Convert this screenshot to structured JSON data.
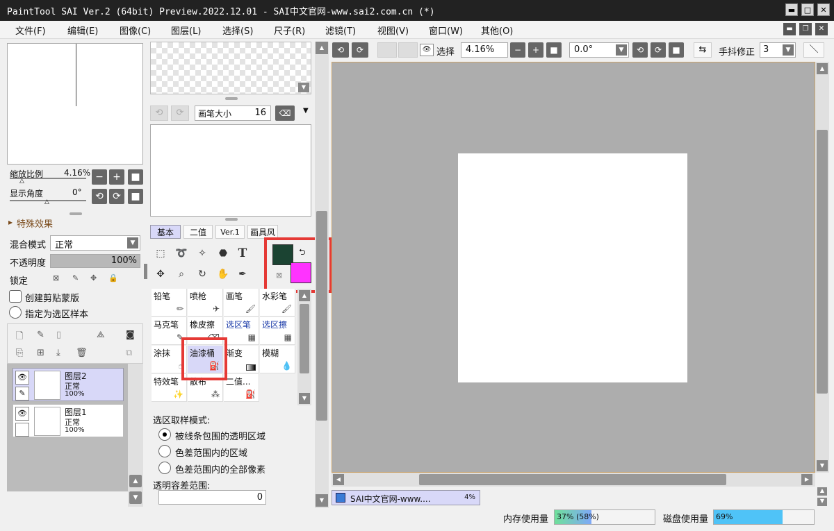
{
  "window": {
    "title": "PaintTool SAI Ver.2 (64bit) Preview.2022.12.01 - SAI中文官网-www.sai2.com.cn (*)",
    "min": "▬",
    "max": "□",
    "close": "✕"
  },
  "menu": [
    "文件(F)",
    "编辑(E)",
    "图像(C)",
    "图层(L)",
    "选择(S)",
    "尺子(R)",
    "滤镜(T)",
    "视图(V)",
    "窗口(W)",
    "其他(O)"
  ],
  "menu_buttons": {
    "min": "▬",
    "restore": "❐",
    "close": "✕"
  },
  "navigator": {
    "zoom_label": "缩放比例",
    "zoom_value": "4.16%",
    "angle_label": "显示角度",
    "angle_value": "0°"
  },
  "effects": {
    "label": "特殊效果"
  },
  "layer_props": {
    "blend_label": "混合模式",
    "blend_value": "正常",
    "opacity_label": "不透明度",
    "opacity_value": "100%",
    "opacity_fraction": 1.0,
    "lock_label": "锁定",
    "clip_label": "创建剪贴蒙版",
    "sample_label": "指定为选区样本"
  },
  "layers": [
    {
      "name": "图层2",
      "mode": "正常",
      "opacity": "100%",
      "selected": true
    },
    {
      "name": "图层1",
      "mode": "正常",
      "opacity": "100%",
      "selected": false
    }
  ],
  "brush_settings": {
    "size_label": "画笔大小",
    "size_value": "16"
  },
  "tool_tabs": [
    "基本",
    "二值",
    "Ver.1",
    "画具风"
  ],
  "colors": {
    "primary": "#1b4332",
    "secondary": "#ff33ff",
    "highlight": "#e53935"
  },
  "brushes": [
    {
      "name": "铅笔"
    },
    {
      "name": "喷枪"
    },
    {
      "name": "画笔"
    },
    {
      "name": "水彩笔"
    },
    {
      "name": "马克笔"
    },
    {
      "name": "橡皮擦"
    },
    {
      "name": "选区笔"
    },
    {
      "name": "选区擦"
    },
    {
      "name": "涂抹"
    },
    {
      "name": "油漆桶"
    },
    {
      "name": "渐变"
    },
    {
      "name": "模糊"
    },
    {
      "name": "特效笔"
    },
    {
      "name": "散布"
    },
    {
      "name": "二值..."
    }
  ],
  "selection_mode": {
    "label": "选区取样模式:",
    "options": [
      "被线条包围的透明区域",
      "色差范围内的区域",
      "色差范围内的全部像素"
    ],
    "selected": 0,
    "tolerance_label": "透明容差范围:",
    "tolerance_value": "0"
  },
  "canvas_toolbar": {
    "select_label": "选择",
    "zoom_value": "4.16%",
    "angle_value": "0.0°",
    "stabilizer_label": "手抖修正",
    "stabilizer_value": "3"
  },
  "canvas_tab": {
    "title": "SAI中文官网-www....",
    "zoom": "4%"
  },
  "status": {
    "memory_label": "内存使用量",
    "memory_value": "37% (58%)",
    "memory_fraction": 0.37,
    "disk_label": "磁盘使用量",
    "disk_value": "69%",
    "disk_fraction": 0.69
  }
}
